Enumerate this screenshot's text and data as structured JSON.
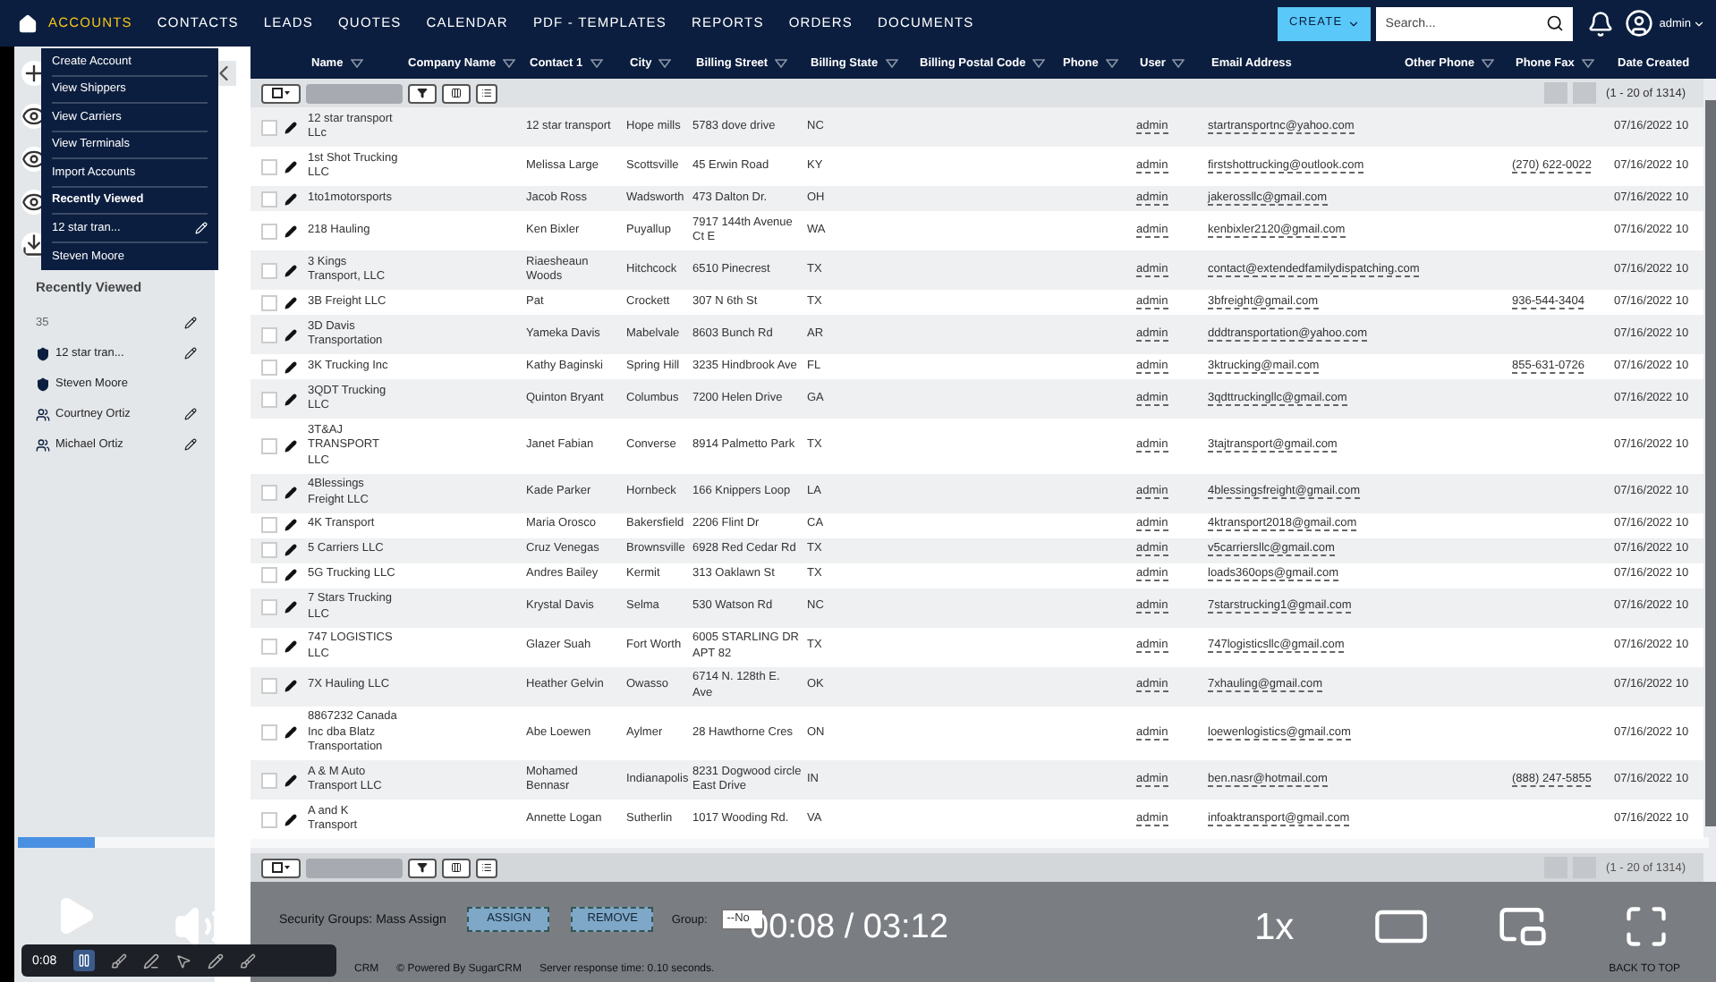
{
  "nav": {
    "items": [
      {
        "label": "ACCOUNTS",
        "selected": true
      },
      {
        "label": "CONTACTS",
        "selected": false
      },
      {
        "label": "LEADS",
        "selected": false
      },
      {
        "label": "QUOTES",
        "selected": false
      },
      {
        "label": "CALENDAR",
        "selected": false
      },
      {
        "label": "PDF - TEMPLATES",
        "selected": false
      },
      {
        "label": "REPORTS",
        "selected": false
      },
      {
        "label": "ORDERS",
        "selected": false
      },
      {
        "label": "DOCUMENTS",
        "selected": false
      }
    ],
    "create_button": "CREATE",
    "search": {
      "placeholder": "Search..."
    },
    "user": "admin"
  },
  "accounts_menu": {
    "items": [
      {
        "label": "Create Account",
        "kind": "action",
        "editable": false
      },
      {
        "label": "View Shippers",
        "kind": "action",
        "editable": false
      },
      {
        "label": "View Carriers",
        "kind": "action",
        "editable": false
      },
      {
        "label": "View Terminals",
        "kind": "action",
        "editable": false
      },
      {
        "label": "Import Accounts",
        "kind": "action",
        "editable": false
      },
      {
        "label": "Recently Viewed",
        "kind": "heading",
        "editable": false
      },
      {
        "label": "12 star tran...",
        "kind": "recent",
        "editable": true
      },
      {
        "label": "Steven Moore",
        "kind": "recent",
        "editable": false
      }
    ]
  },
  "sidebar": {
    "title": "Recently Viewed",
    "items": [
      {
        "label": "35",
        "kind": "plain",
        "editable": true
      },
      {
        "label": "12 star tran...",
        "kind": "account",
        "editable": true
      },
      {
        "label": "Steven Moore",
        "kind": "account",
        "editable": false
      },
      {
        "label": "Courtney Ortiz",
        "kind": "contact",
        "editable": true
      },
      {
        "label": "Michael Ortiz",
        "kind": "contact",
        "editable": true
      }
    ]
  },
  "table": {
    "columns": [
      {
        "label": "Name",
        "filter": true
      },
      {
        "label": "Company Name",
        "filter": true
      },
      {
        "label": "Contact 1",
        "filter": true
      },
      {
        "label": "City",
        "filter": true
      },
      {
        "label": "Billing Street",
        "filter": true
      },
      {
        "label": "Billing State",
        "filter": true
      },
      {
        "label": "Billing Postal Code",
        "filter": true
      },
      {
        "label": "Phone",
        "filter": true
      },
      {
        "label": "User",
        "filter": true
      },
      {
        "label": "Email Address",
        "filter": false
      },
      {
        "label": "Other Phone",
        "filter": true
      },
      {
        "label": "Phone Fax",
        "filter": true
      },
      {
        "label": "Date Created",
        "filter": false
      }
    ],
    "pagination": "(1 - 20 of 1314)",
    "rows": [
      {
        "checked": false,
        "name": "12 star transport LLc",
        "contact": "12 star transport",
        "city": "Hope mills",
        "street": "5783 dove drive",
        "state": "NC",
        "user": "admin",
        "email": "startransportnc@yahoo.com",
        "date": "07/16/2022 10"
      },
      {
        "checked": false,
        "name": "1st Shot Trucking LLC",
        "contact": "Melissa Large",
        "city": "Scottsville",
        "street": "45 Erwin Road",
        "state": "KY",
        "user": "admin",
        "email": "firstshottrucking@outlook.com",
        "fax": "(270) 622-0022",
        "date": "07/16/2022 10"
      },
      {
        "checked": false,
        "name": "1to1motorsports",
        "contact": "Jacob Ross",
        "city": "Wadsworth",
        "street": "473 Dalton Dr.",
        "state": "OH",
        "user": "admin",
        "email": "jakerossllc@gmail.com",
        "date": "07/16/2022 10"
      },
      {
        "checked": false,
        "name": "218 Hauling",
        "contact": "Ken Bixler",
        "city": "Puyallup",
        "street": "7917 144th Avenue Ct E",
        "state": "WA",
        "user": "admin",
        "email": "kenbixler2120@gmail.com",
        "date": "07/16/2022 10"
      },
      {
        "checked": false,
        "name": "3 Kings Transport, LLC",
        "contact": "Riaesheaun Woods",
        "city": "Hitchcock",
        "street": "6510 Pinecrest",
        "state": "TX",
        "user": "admin",
        "email": "contact@extendedfamilydispatching.com",
        "date": "07/16/2022 10"
      },
      {
        "checked": false,
        "name": "3B Freight LLC",
        "contact": "Pat",
        "city": "Crockett",
        "street": "307 N 6th St",
        "state": "TX",
        "user": "admin",
        "email": "3bfreight@gmail.com",
        "fax": "936-544-3404",
        "date": "07/16/2022 10"
      },
      {
        "checked": false,
        "name": "3D Davis Transportation",
        "contact": "Yameka Davis",
        "city": "Mabelvale",
        "street": "8603 Bunch Rd",
        "state": "AR",
        "user": "admin",
        "email": "dddtransportation@yahoo.com",
        "date": "07/16/2022 10"
      },
      {
        "checked": false,
        "name": "3K Trucking Inc",
        "contact": "Kathy Baginski",
        "city": "Spring Hill",
        "street": "3235 Hindbrook Ave",
        "state": "FL",
        "user": "admin",
        "email": "3ktrucking@mail.com",
        "fax": "855-631-0726",
        "date": "07/16/2022 10"
      },
      {
        "checked": false,
        "name": "3QDT Trucking LLC",
        "contact": "Quinton Bryant",
        "city": "Columbus",
        "street": "7200 Helen Drive",
        "state": "GA",
        "user": "admin",
        "email": "3qdttruckingllc@gmail.com",
        "date": "07/16/2022 10"
      },
      {
        "checked": false,
        "name": "3T&AJ TRANSPORT LLC",
        "contact": "Janet Fabian",
        "city": "Converse",
        "street": "8914 Palmetto Park",
        "state": "TX",
        "user": "admin",
        "email": "3tajtransport@gmail.com",
        "date": "07/16/2022 10"
      },
      {
        "checked": false,
        "name": "4Blessings Freight LLC",
        "contact": "Kade Parker",
        "city": "Hornbeck",
        "street": "166 Knippers Loop",
        "state": "LA",
        "user": "admin",
        "email": "4blessingsfreight@gmail.com",
        "date": "07/16/2022 10"
      },
      {
        "checked": false,
        "name": "4K Transport",
        "contact": "Maria Orosco",
        "city": "Bakersfield",
        "street": "2206 Flint Dr",
        "state": "CA",
        "user": "admin",
        "email": "4ktransport2018@gmail.com",
        "date": "07/16/2022 10"
      },
      {
        "checked": false,
        "name": "5 Carriers LLC",
        "contact": "Cruz Venegas",
        "city": "Brownsville",
        "street": "6928 Red Cedar Rd",
        "state": "TX",
        "user": "admin",
        "email": "v5carriersllc@gmail.com",
        "date": "07/16/2022 10"
      },
      {
        "checked": false,
        "name": "5G Trucking LLC",
        "contact": "Andres Bailey",
        "city": "Kermit",
        "street": "313 Oaklawn St",
        "state": "TX",
        "user": "admin",
        "email": "loads360ops@gmail.com",
        "date": "07/16/2022 10"
      },
      {
        "checked": false,
        "name": "7 Stars Trucking LLC",
        "contact": "Krystal Davis",
        "city": "Selma",
        "street": "530 Watson Rd",
        "state": "NC",
        "user": "admin",
        "email": "7starstrucking1@gmail.com",
        "date": "07/16/2022 10"
      },
      {
        "checked": false,
        "name": "747 LOGISTICS LLC",
        "contact": "Glazer Suah",
        "city": "Fort Worth",
        "street": "6005 STARLING DR APT 82",
        "state": "TX",
        "user": "admin",
        "email": "747logisticsllc@gmail.com",
        "date": "07/16/2022 10"
      },
      {
        "checked": false,
        "name": "7X Hauling LLC",
        "contact": "Heather Gelvin",
        "city": "Owasso",
        "street": "6714 N. 128th E. Ave",
        "state": "OK",
        "user": "admin",
        "email": "7xhauling@gmail.com",
        "date": "07/16/2022 10"
      },
      {
        "checked": false,
        "name": "8867232 Canada Inc dba Blatz Transportation",
        "contact": "Abe Loewen",
        "city": "Aylmer",
        "street": "28 Hawthorne Cres",
        "state": "ON",
        "user": "admin",
        "email": "loewenlogistics@gmail.com",
        "date": "07/16/2022 10"
      },
      {
        "checked": false,
        "name": "A & M Auto Transport LLC",
        "contact": "Mohamed Bennasr",
        "city": "Indianapolis",
        "street": "8231 Dogwood circle East Drive",
        "state": "IN",
        "user": "admin",
        "email": "ben.nasr@hotmail.com",
        "fax": "(888) 247-5855",
        "date": "07/16/2022 10"
      },
      {
        "checked": false,
        "name": "A and K Transport",
        "contact": "Annette Logan",
        "city": "Sutherlin",
        "street": "1017 Wooding Rd.",
        "state": "VA",
        "user": "admin",
        "email": "infoaktransport@gmail.com",
        "date": "07/16/2022 10"
      }
    ],
    "bottom_pagination": "(1 - 20 of 1314)"
  },
  "mass_assign": {
    "label": "Security Groups: Mass Assign",
    "buttons": [
      "ASSIGN",
      "REMOVE"
    ],
    "group_label": "Group:",
    "group_value": "--No"
  },
  "footer": {
    "left": "CRM",
    "powered": "© Powered By SugarCRM",
    "response": "Server response time: 0.10 seconds.",
    "back_to_top": "BACK TO TOP"
  },
  "video": {
    "playing": false,
    "level": 0.046,
    "time": "00:08 / 03:12",
    "speed": "1x",
    "recorder_time": "0:08"
  }
}
